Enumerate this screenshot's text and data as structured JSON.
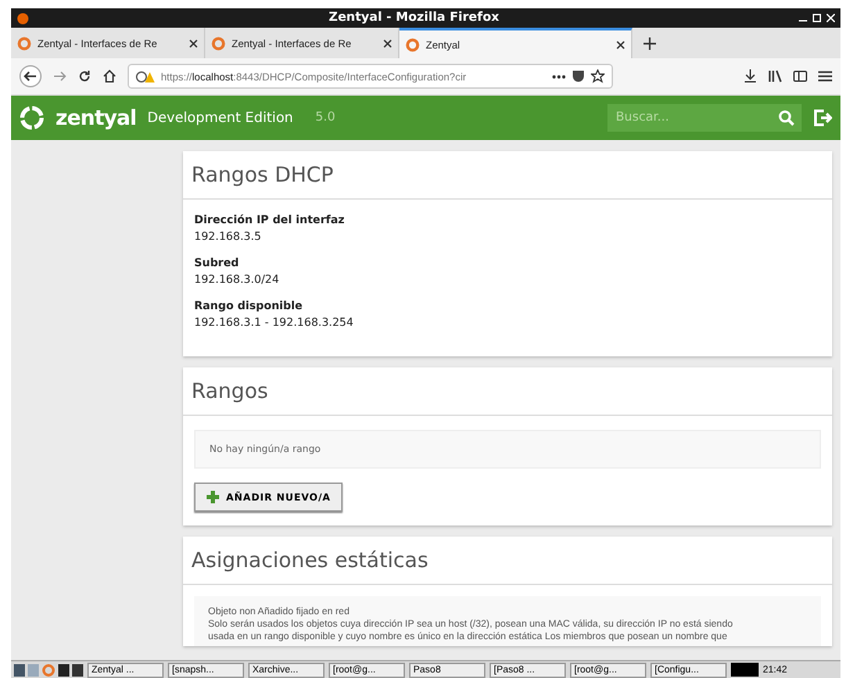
{
  "window": {
    "title": "Zentyal - Mozilla Firefox"
  },
  "tabs": [
    {
      "label": "Zentyal - Interfaces de Re",
      "selected": false
    },
    {
      "label": "Zentyal - Interfaces de Re",
      "selected": false
    },
    {
      "label": "Zentyal",
      "selected": true
    }
  ],
  "address_bar": {
    "url_prefix": "https://",
    "url_host": "localhost",
    "url_rest": ":8443/DHCP/Composite/InterfaceConfiguration?cir"
  },
  "app_header": {
    "logo": "zentyal",
    "edition": "Development Edition",
    "version": "5.0",
    "search_placeholder": "Buscar..."
  },
  "cards": [
    {
      "kind": "info",
      "title": "Rangos DHCP",
      "fields": [
        {
          "label": "Dirección IP del interfaz",
          "value": "192.168.3.5"
        },
        {
          "label": "Subred",
          "value": "192.168.3.0/24"
        },
        {
          "label": "Rango disponible",
          "value": "192.168.3.1 - 192.168.3.254"
        }
      ]
    },
    {
      "kind": "list",
      "title": "Rangos",
      "empty_message": "No hay ningún/a rango",
      "add_button": "AÑADIR NUEVO/A"
    },
    {
      "kind": "note",
      "title": "Asignaciones estáticas",
      "note_title": "Objeto non Añadido fijado en red",
      "note_lines": [
        "Solo serán usados los objetos cuya dirección IP sea un host (/32), posean una MAC válida, su dirección IP no está siendo",
        "usada en un rango disponible y cuyo nombre es único en la dirección estática Los miembros que posean un nombre que"
      ]
    }
  ],
  "taskbar": {
    "items": [
      "Zentyal ...",
      "[snapsh...",
      "Xarchive...",
      "[root@g...",
      "Paso8",
      "[Paso8 ...",
      "[root@g...",
      "[Configu..."
    ],
    "clock": "21:42"
  }
}
